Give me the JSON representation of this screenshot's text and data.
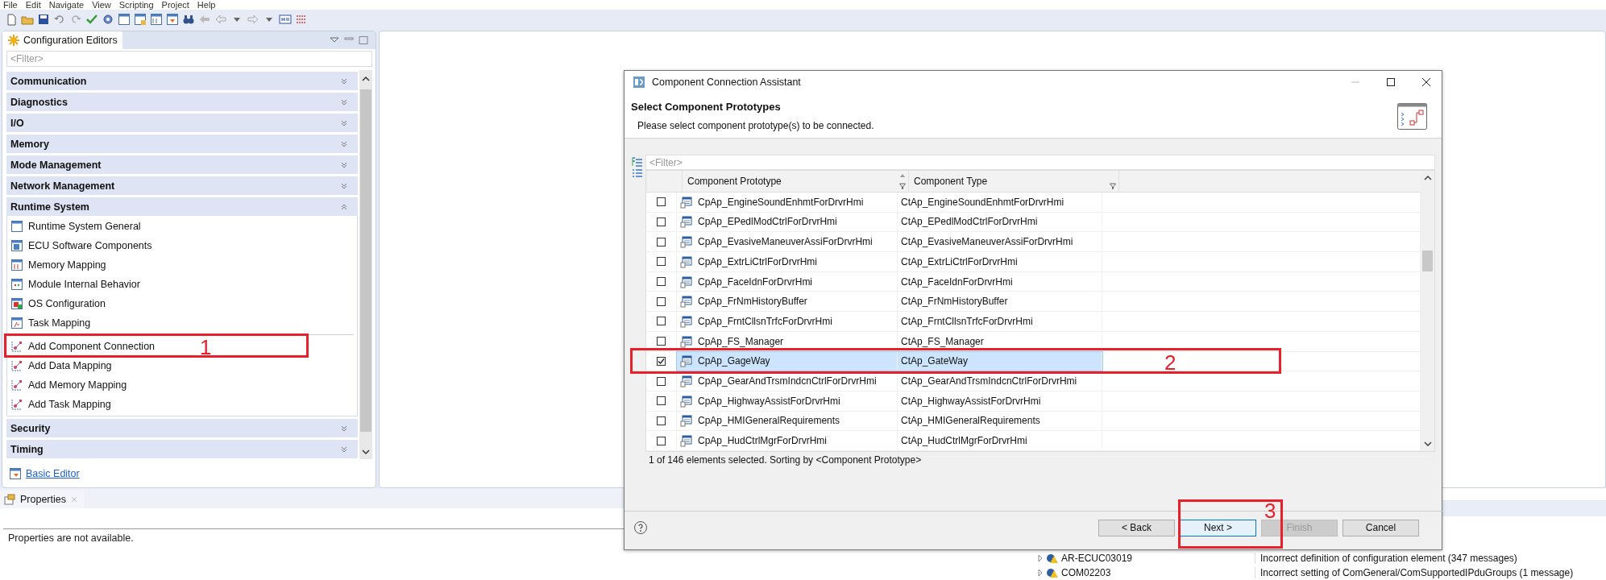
{
  "menu": [
    "File",
    "Edit",
    "Navigate",
    "View",
    "Scripting",
    "Project",
    "Help"
  ],
  "config_editors": {
    "tab": "Configuration Editors",
    "filter_placeholder": "<Filter>",
    "sections": [
      {
        "title": "Communication",
        "expanded": false
      },
      {
        "title": "Diagnostics",
        "expanded": false
      },
      {
        "title": "I/O",
        "expanded": false
      },
      {
        "title": "Memory",
        "expanded": false
      },
      {
        "title": "Mode Management",
        "expanded": false
      },
      {
        "title": "Network Management",
        "expanded": false
      },
      {
        "title": "Runtime System",
        "expanded": true,
        "items": [
          "Runtime System General",
          "ECU Software Components",
          "Memory Mapping",
          "Module Internal Behavior",
          "OS Configuration",
          "Task Mapping"
        ],
        "actions": [
          "Add Component Connection",
          "Add Data Mapping",
          "Add Memory Mapping",
          "Add Task Mapping"
        ]
      },
      {
        "title": "Security",
        "expanded": false
      },
      {
        "title": "Timing",
        "expanded": false
      }
    ],
    "basic_editor": "Basic Editor"
  },
  "properties": {
    "tab": "Properties",
    "message": "Properties are not available."
  },
  "problems": {
    "rows": [
      {
        "id": "AR-ECUC03019",
        "message": "Incorrect definition of configuration element  (347 messages)"
      },
      {
        "id": "COM02203",
        "message": "Incorrect setting of ComGeneral/ComSupportedIPduGroups  (1 message)"
      }
    ]
  },
  "dialog": {
    "title": "Component Connection Assistant",
    "heading": "Select Component Prototypes",
    "description": "Please select component prototype(s) to be connected.",
    "filter_placeholder": "<Filter>",
    "columns": [
      "Component Prototype",
      "Component Type"
    ],
    "rows": [
      {
        "prototype": "CpAp_EngineSoundEnhmtForDrvrHmi",
        "type": "CtAp_EngineSoundEnhmtForDrvrHmi",
        "checked": false,
        "selected": false
      },
      {
        "prototype": "CpAp_EPedlModCtrlForDrvrHmi",
        "type": "CtAp_EPedlModCtrlForDrvrHmi",
        "checked": false,
        "selected": false
      },
      {
        "prototype": "CpAp_EvasiveManeuverAssiForDrvrHmi",
        "type": "CtAp_EvasiveManeuverAssiForDrvrHmi",
        "checked": false,
        "selected": false
      },
      {
        "prototype": "CpAp_ExtrLiCtrlForDrvrHmi",
        "type": "CtAp_ExtrLiCtrlForDrvrHmi",
        "checked": false,
        "selected": false
      },
      {
        "prototype": "CpAp_FaceIdnForDrvrHmi",
        "type": "CtAp_FaceIdnForDrvrHmi",
        "checked": false,
        "selected": false
      },
      {
        "prototype": "CpAp_FrNmHistoryBuffer",
        "type": "CtAp_FrNmHistoryBuffer",
        "checked": false,
        "selected": false
      },
      {
        "prototype": "CpAp_FrntCllsnTrfcForDrvrHmi",
        "type": "CtAp_FrntCllsnTrfcForDrvrHmi",
        "checked": false,
        "selected": false
      },
      {
        "prototype": "CpAp_FS_Manager",
        "type": "CtAp_FS_Manager",
        "checked": false,
        "selected": false
      },
      {
        "prototype": "CpAp_GageWay",
        "type": "CtAp_GateWay",
        "checked": true,
        "selected": true
      },
      {
        "prototype": "CpAp_GearAndTrsmIndcnCtrlForDrvrHmi",
        "type": "CtAp_GearAndTrsmIndcnCtrlForDrvrHmi",
        "checked": false,
        "selected": false
      },
      {
        "prototype": "CpAp_HighwayAssistForDrvrHmi",
        "type": "CtAp_HighwayAssistForDrvrHmi",
        "checked": false,
        "selected": false
      },
      {
        "prototype": "CpAp_HMIGeneralRequirements",
        "type": "CtAp_HMIGeneralRequirements",
        "checked": false,
        "selected": false
      },
      {
        "prototype": "CpAp_HudCtrlMgrForDrvrHmi",
        "type": "CtAp_HudCtrlMgrForDrvrHmi",
        "checked": false,
        "selected": false
      }
    ],
    "status": "1 of 146 elements selected. Sorting by <Component Prototype>",
    "buttons": [
      {
        "label": "< Back",
        "default": false,
        "disabled": false
      },
      {
        "label": "Next >",
        "default": true,
        "disabled": false
      },
      {
        "label": "Finish",
        "default": false,
        "disabled": true
      },
      {
        "label": "Cancel",
        "default": false,
        "disabled": false
      }
    ]
  },
  "annotations": [
    {
      "label": "1"
    },
    {
      "label": "2"
    },
    {
      "label": "3"
    }
  ]
}
